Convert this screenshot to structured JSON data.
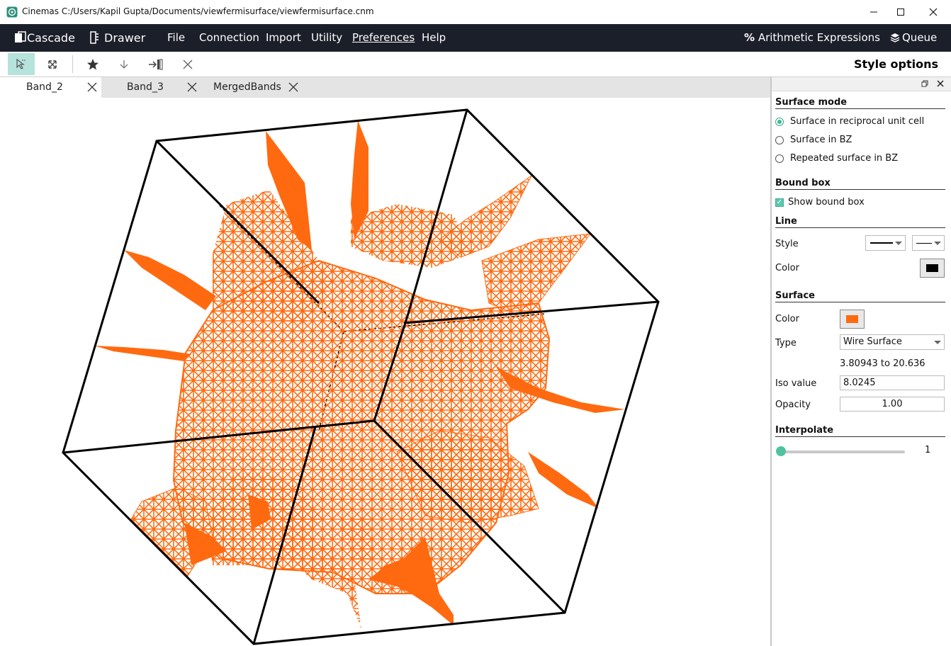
{
  "window": {
    "app_name": "Cinemas",
    "file_path": "C:/Users/Kapil Gupta/Documents/viewfermisurface/viewfermisurface.cnm"
  },
  "menubar": {
    "cascade": "Cascade",
    "drawer": "Drawer",
    "items": [
      "File",
      "Connection",
      "Import",
      "Utility",
      "Preferences",
      "Help"
    ],
    "arithmetic": "Arithmetic Expressions",
    "queue": "Queue"
  },
  "toolbar": {
    "panel_title": "Style options"
  },
  "tabs": [
    {
      "label": "Band_2",
      "active": true
    },
    {
      "label": "Band_3",
      "active": false
    },
    {
      "label": "MergedBands",
      "active": false
    }
  ],
  "style_panel": {
    "surface_mode": {
      "title": "Surface mode",
      "options": [
        "Surface in reciprocal unit cell",
        "Surface in BZ",
        "Repeated surface in BZ"
      ],
      "selected_index": 0
    },
    "bound_box": {
      "title": "Bound box",
      "show_label": "Show bound box",
      "checked": true
    },
    "line": {
      "title": "Line",
      "style_label": "Style",
      "color_label": "Color",
      "color": "#000000"
    },
    "surface": {
      "title": "Surface",
      "color_label": "Color",
      "color": "#ff6a10",
      "type_label": "Type",
      "type_value": "Wire Surface",
      "range_text": "3.80943 to 20.636",
      "iso_label": "Iso value",
      "iso_value": "8.0245",
      "opacity_label": "Opacity",
      "opacity_value": "1.00"
    },
    "interpolate": {
      "title": "Interpolate",
      "value": "1"
    }
  },
  "colors": {
    "menubar_bg": "#1b1f2a",
    "accent": "#4fc3a1",
    "surface_orange": "#ff6a10"
  }
}
